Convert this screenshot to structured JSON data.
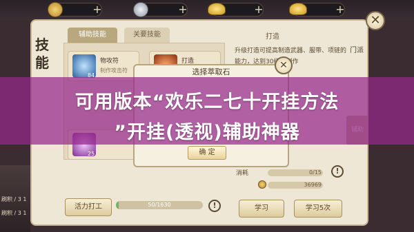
{
  "topbar": {
    "plus": "+",
    "resources": [
      {
        "icon": "gold-coin-icon"
      },
      {
        "icon": "silver-coin-icon"
      },
      {
        "icon": "gold-coin-icon"
      },
      {
        "icon": "gold-ingot-icon"
      },
      {
        "icon": "gold-ingot-icon"
      }
    ],
    "close_label": "✕"
  },
  "panel": {
    "title": "技能",
    "tabs": {
      "active": "辅助技能",
      "inactive": "关要技能"
    },
    "skills": [
      {
        "name": "物攻符",
        "sub": "制作攻击符",
        "level": "84"
      },
      {
        "name": "打造",
        "sub": "",
        "level": ""
      },
      {
        "name": "",
        "sub": "",
        "level": "25"
      }
    ],
    "right_title": "打造",
    "description": "升级打造可提高制造武器、服带、项链的能力，达到30级可制作",
    "sidebar": {
      "faction": "门派",
      "assist": "辅助"
    },
    "costs": [
      {
        "label": "消耗",
        "value": "0/15"
      },
      {
        "label": "",
        "value": "36969"
      }
    ],
    "buttons": {
      "work": "活力打工",
      "learn": "学习",
      "learn5": "学习5次"
    },
    "progress": {
      "text": "50/1630",
      "fraction": 0.031
    }
  },
  "dialog": {
    "title": "选择萃取石",
    "confirm": "确 定",
    "close": "✕"
  },
  "banner": {
    "line1": "可用版本“欢乐二七十开挂方法",
    "line2": "”开挂(透视)辅助神器"
  },
  "left_deco": {
    "text1": "刷积",
    "text2": "刷积 / 3 1",
    "text3": "刷积 / 3 1"
  },
  "colors": {
    "banner": "#962888",
    "panel": "#efe7d5",
    "accent": "#b9a87e"
  }
}
